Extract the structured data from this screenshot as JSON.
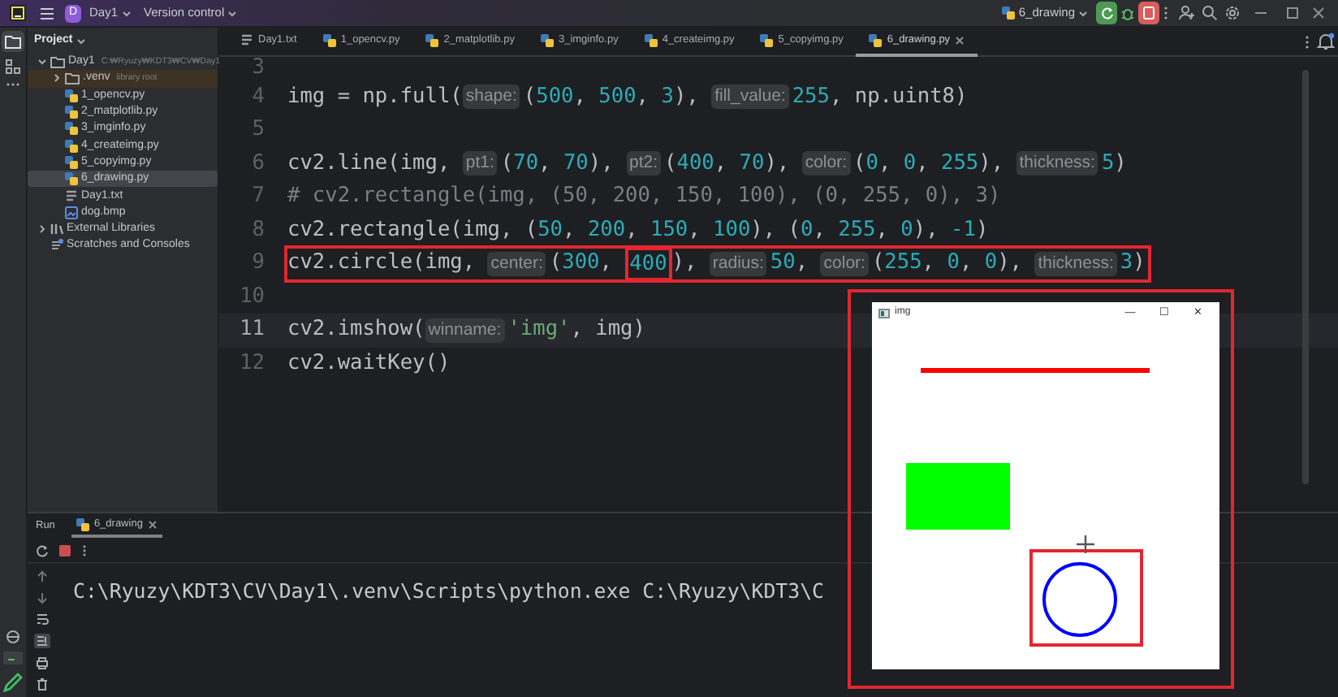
{
  "topbar": {
    "project_badge": "D",
    "project": "Day1",
    "vcs": "Version control",
    "run_config": "6_drawing"
  },
  "project_panel": {
    "title": "Project",
    "tree": [
      {
        "label": "Day1",
        "hint": "C:₩Ryuzy₩KDT3₩CV₩Day1",
        "kind": "folder",
        "expanded": true,
        "selected": false,
        "children": [
          {
            "label": ".venv",
            "hint": "library root",
            "kind": "library_root",
            "expanded": false,
            "selected": false
          },
          {
            "label": "1_opencv.py",
            "kind": "python",
            "selected": false
          },
          {
            "label": "2_matplotlib.py",
            "kind": "python",
            "selected": false
          },
          {
            "label": "3_imginfo.py",
            "kind": "python",
            "selected": false
          },
          {
            "label": "4_createimg.py",
            "kind": "python",
            "selected": false
          },
          {
            "label": "5_copyimg.py",
            "kind": "python",
            "selected": false
          },
          {
            "label": "6_drawing.py",
            "kind": "python",
            "selected": true
          },
          {
            "label": "Day1.txt",
            "kind": "text",
            "selected": false
          },
          {
            "label": "dog.bmp",
            "kind": "image",
            "selected": false
          }
        ]
      },
      {
        "label": "External Libraries",
        "kind": "library",
        "expanded": false,
        "selected": false
      },
      {
        "label": "Scratches and Consoles",
        "kind": "scratch",
        "selected": false
      }
    ]
  },
  "tabs": [
    {
      "label": "Day1.txt",
      "kind": "text",
      "selected": false
    },
    {
      "label": "1_opencv.py",
      "kind": "python",
      "selected": false
    },
    {
      "label": "2_matplotlib.py",
      "kind": "python",
      "selected": false
    },
    {
      "label": "3_imginfo.py",
      "kind": "python",
      "selected": false
    },
    {
      "label": "4_createimg.py",
      "kind": "python",
      "selected": false
    },
    {
      "label": "5_copyimg.py",
      "kind": "python",
      "selected": false
    },
    {
      "label": "6_drawing.py",
      "kind": "python",
      "selected": true
    }
  ],
  "editor": {
    "lines": [
      {
        "number": "3",
        "current": false,
        "boxed": false
      },
      {
        "number": "4",
        "current": false,
        "boxed": false,
        "tokens": [
          {
            "kind": "plain",
            "text": "img = np.full("
          },
          {
            "kind": "hint",
            "text": "shape:"
          },
          {
            "kind": "plain",
            "text": "("
          },
          {
            "kind": "num",
            "text": "500"
          },
          {
            "kind": "plain",
            "text": ", "
          },
          {
            "kind": "num",
            "text": "500"
          },
          {
            "kind": "plain",
            "text": ", "
          },
          {
            "kind": "num",
            "text": "3"
          },
          {
            "kind": "plain",
            "text": "), "
          },
          {
            "kind": "hint",
            "text": "fill_value:"
          },
          {
            "kind": "num",
            "text": "255"
          },
          {
            "kind": "plain",
            "text": ", np.uint8)"
          }
        ]
      },
      {
        "number": "5",
        "current": false,
        "boxed": false
      },
      {
        "number": "6",
        "current": false,
        "boxed": false,
        "tokens": [
          {
            "kind": "plain",
            "text": "cv2.line(img, "
          },
          {
            "kind": "hint",
            "text": "pt1:"
          },
          {
            "kind": "plain",
            "text": "("
          },
          {
            "kind": "num",
            "text": "70"
          },
          {
            "kind": "plain",
            "text": ", "
          },
          {
            "kind": "num",
            "text": "70"
          },
          {
            "kind": "plain",
            "text": "), "
          },
          {
            "kind": "hint",
            "text": "pt2:"
          },
          {
            "kind": "plain",
            "text": "("
          },
          {
            "kind": "num",
            "text": "400"
          },
          {
            "kind": "plain",
            "text": ", "
          },
          {
            "kind": "num",
            "text": "70"
          },
          {
            "kind": "plain",
            "text": "), "
          },
          {
            "kind": "hint",
            "text": "color:"
          },
          {
            "kind": "plain",
            "text": "("
          },
          {
            "kind": "num",
            "text": "0"
          },
          {
            "kind": "plain",
            "text": ", "
          },
          {
            "kind": "num",
            "text": "0"
          },
          {
            "kind": "plain",
            "text": ", "
          },
          {
            "kind": "num",
            "text": "255"
          },
          {
            "kind": "plain",
            "text": "), "
          },
          {
            "kind": "hint",
            "text": "thickness:"
          },
          {
            "kind": "num",
            "text": "5"
          },
          {
            "kind": "plain",
            "text": ")"
          }
        ]
      },
      {
        "number": "7",
        "current": false,
        "boxed": false,
        "tokens": [
          {
            "kind": "comment",
            "text": "# cv2.rectangle(img, (50, 200, 150, 100), (0, 255, 0), 3)"
          }
        ]
      },
      {
        "number": "8",
        "current": false,
        "boxed": false,
        "tokens": [
          {
            "kind": "plain",
            "text": "cv2.rectangle(img, ("
          },
          {
            "kind": "num",
            "text": "50"
          },
          {
            "kind": "plain",
            "text": ", "
          },
          {
            "kind": "num",
            "text": "200"
          },
          {
            "kind": "plain",
            "text": ", "
          },
          {
            "kind": "num",
            "text": "150"
          },
          {
            "kind": "plain",
            "text": ", "
          },
          {
            "kind": "num",
            "text": "100"
          },
          {
            "kind": "plain",
            "text": "), ("
          },
          {
            "kind": "num",
            "text": "0"
          },
          {
            "kind": "plain",
            "text": ", "
          },
          {
            "kind": "num",
            "text": "255"
          },
          {
            "kind": "plain",
            "text": ", "
          },
          {
            "kind": "num",
            "text": "0"
          },
          {
            "kind": "plain",
            "text": "), "
          },
          {
            "kind": "num",
            "text": "-1"
          },
          {
            "kind": "plain",
            "text": ")"
          }
        ]
      },
      {
        "number": "9",
        "current": false,
        "boxed": true,
        "tokens": [
          {
            "kind": "plain",
            "text": "cv2.circle(img, "
          },
          {
            "kind": "hint",
            "text": "center:"
          },
          {
            "kind": "plain",
            "text": "("
          },
          {
            "kind": "num",
            "text": "300"
          },
          {
            "kind": "plain",
            "text": ", "
          },
          {
            "kind": "num",
            "text": "400",
            "boxed": true
          },
          {
            "kind": "plain",
            "text": "), "
          },
          {
            "kind": "hint",
            "text": "radius:"
          },
          {
            "kind": "num",
            "text": "50"
          },
          {
            "kind": "plain",
            "text": ", "
          },
          {
            "kind": "hint",
            "text": "color:"
          },
          {
            "kind": "plain",
            "text": "("
          },
          {
            "kind": "num",
            "text": "255"
          },
          {
            "kind": "plain",
            "text": ", "
          },
          {
            "kind": "num",
            "text": "0"
          },
          {
            "kind": "plain",
            "text": ", "
          },
          {
            "kind": "num",
            "text": "0"
          },
          {
            "kind": "plain",
            "text": "), "
          },
          {
            "kind": "hint",
            "text": "thickness:"
          },
          {
            "kind": "num",
            "text": "3"
          },
          {
            "kind": "plain",
            "text": ")"
          }
        ]
      },
      {
        "number": "10",
        "current": false,
        "boxed": false
      },
      {
        "number": "11",
        "current": true,
        "boxed": false,
        "tokens": [
          {
            "kind": "plain",
            "text": "cv2.imshow("
          },
          {
            "kind": "hint",
            "text": "winname:"
          },
          {
            "kind": "str",
            "text": "'img'"
          },
          {
            "kind": "plain",
            "text": ", img)"
          }
        ]
      },
      {
        "number": "12",
        "current": false,
        "boxed": false,
        "tokens": [
          {
            "kind": "plain",
            "text": "cv2.waitKey()"
          }
        ]
      }
    ]
  },
  "run_panel": {
    "title": "Run",
    "tabs": [
      {
        "label": "6_drawing",
        "selected": true
      }
    ],
    "output": "C:\\Ryuzy\\KDT3\\CV\\Day1\\.venv\\Scripts\\python.exe C:\\Ryuzy\\KDT3\\C"
  },
  "image_window": {
    "title": "img",
    "boxed": true,
    "circle_boxed": true,
    "controls": [
      "—",
      "☐",
      "✕"
    ]
  }
}
